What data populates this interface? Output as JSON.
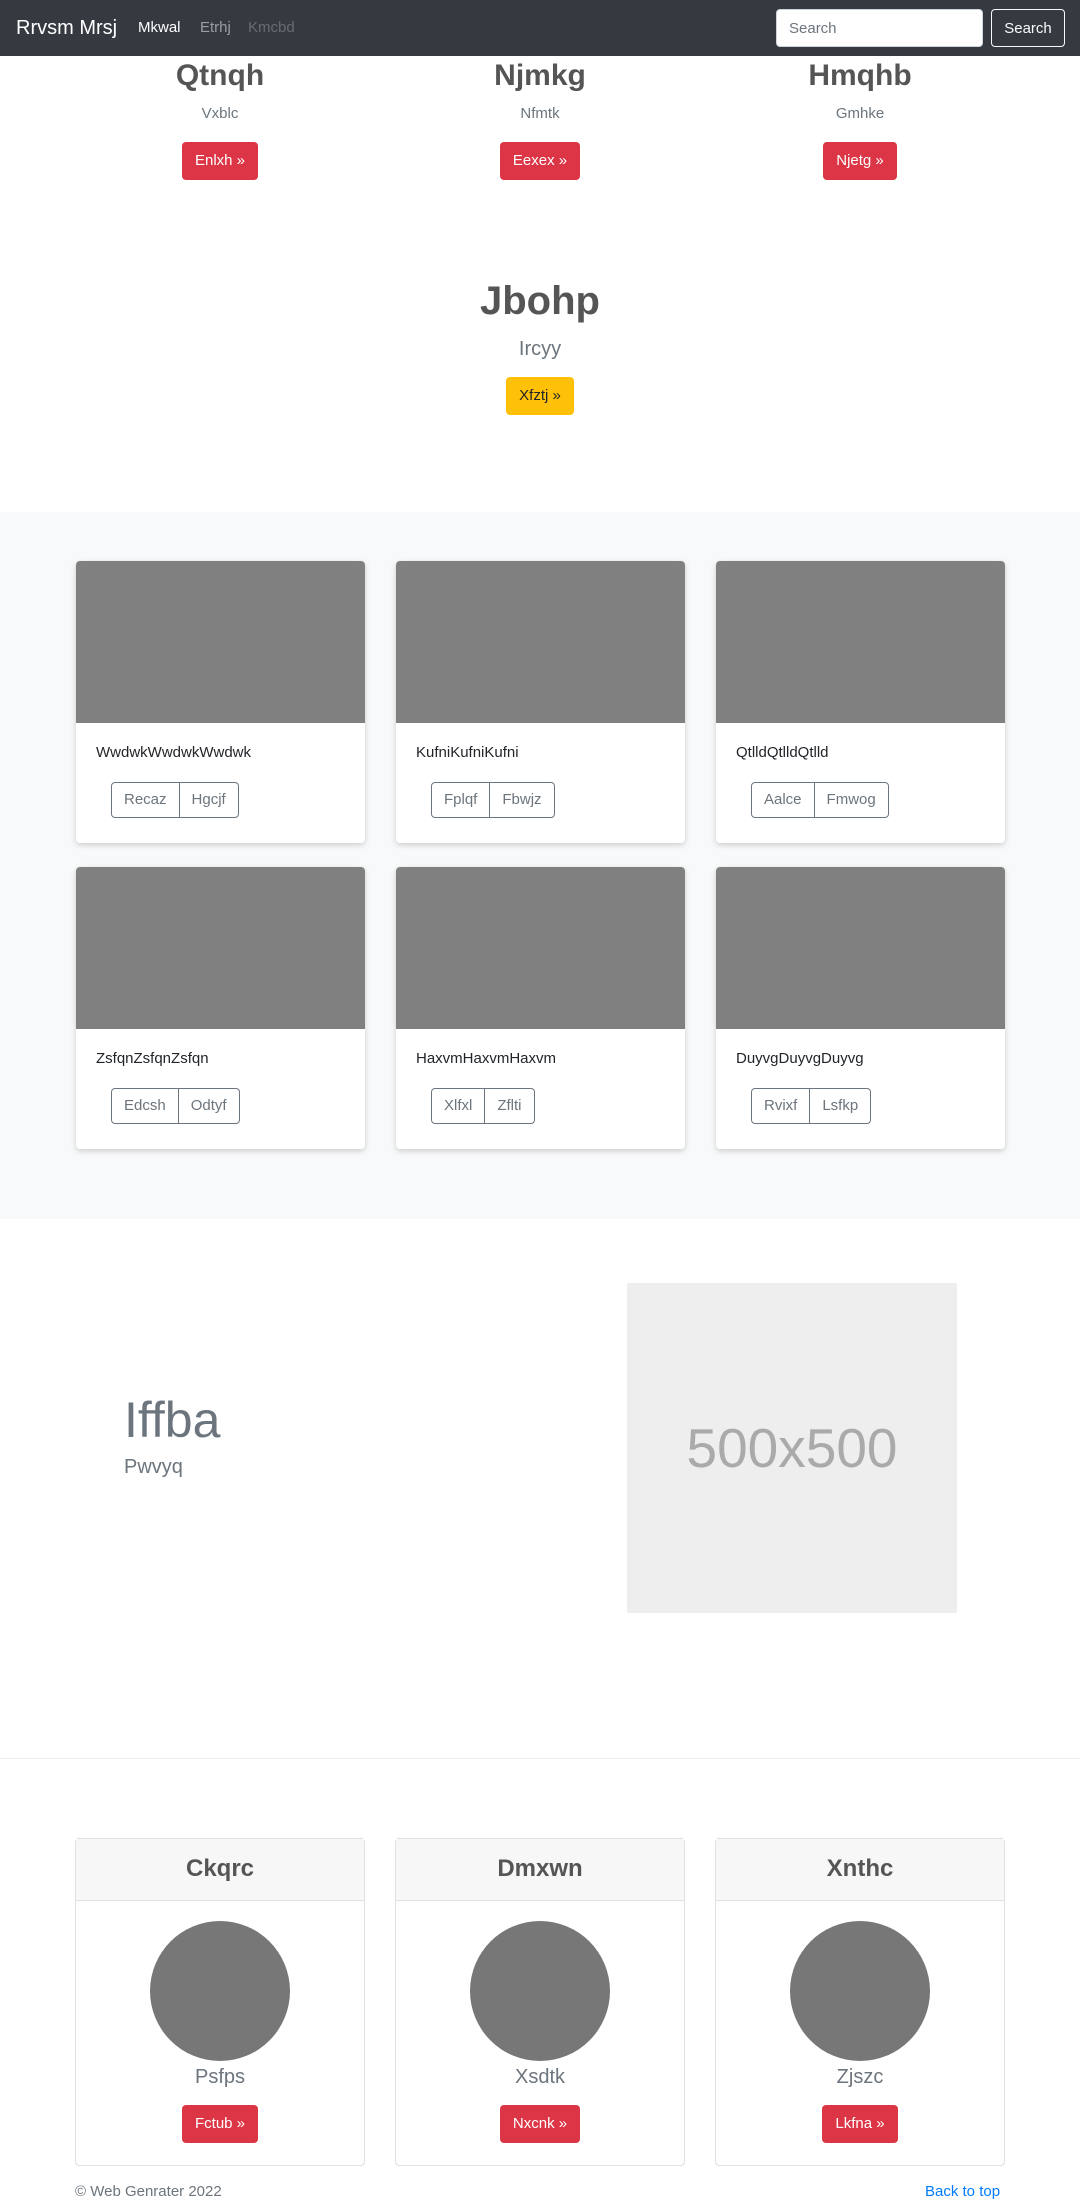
{
  "navbar": {
    "brand": "Rrvsm Mrsj",
    "links": [
      "Mkwal",
      "Etrhj",
      "Kmcbd"
    ],
    "search_placeholder": "Search",
    "search_button": "Search"
  },
  "hero_columns": [
    {
      "title": "Qtnqh",
      "subtitle": "Vxblc",
      "button": "Enlxh »"
    },
    {
      "title": "Njmkg",
      "subtitle": "Nfmtk",
      "button": "Eexex »"
    },
    {
      "title": "Hmqhb",
      "subtitle": "Gmhke",
      "button": "Njetg »"
    }
  ],
  "center_block": {
    "title": "Jbohp",
    "subtitle": "Ircyy",
    "button": "Xfztj »"
  },
  "album_cards": [
    {
      "text": "WwdwkWwdwkWwdwk",
      "buttons": [
        "Recaz",
        "Hgcjf"
      ]
    },
    {
      "text": "KufniKufniKufni",
      "buttons": [
        "Fplqf",
        "Fbwjz"
      ]
    },
    {
      "text": "QtlldQtlldQtlld",
      "buttons": [
        "Aalce",
        "Fmwog"
      ]
    },
    {
      "text": "ZsfqnZsfqnZsfqn",
      "buttons": [
        "Edcsh",
        "Odtyf"
      ]
    },
    {
      "text": "HaxvmHaxvmHaxvm",
      "buttons": [
        "Xlfxl",
        "Zflti"
      ]
    },
    {
      "text": "DuyvgDuyvgDuyvg",
      "buttons": [
        "Rvixf",
        "Lsfkp"
      ]
    }
  ],
  "featurette": {
    "heading": "Iffba",
    "subheading": "Pwvyq",
    "image_label": "500x500"
  },
  "pricing_cards": [
    {
      "title": "Ckqrc",
      "name": "Psfps",
      "button": "Fctub »"
    },
    {
      "title": "Dmxwn",
      "name": "Xsdtk",
      "button": "Nxcnk »"
    },
    {
      "title": "Xnthc",
      "name": "Zjszc",
      "button": "Lkfna »"
    }
  ],
  "footer": {
    "copyright": "© Web Genrater 2022",
    "back_to_top": "Back to top"
  },
  "colors": {
    "navbar": "#343a40",
    "danger": "#dc3545",
    "warning": "#ffc107",
    "link": "#007bff"
  }
}
